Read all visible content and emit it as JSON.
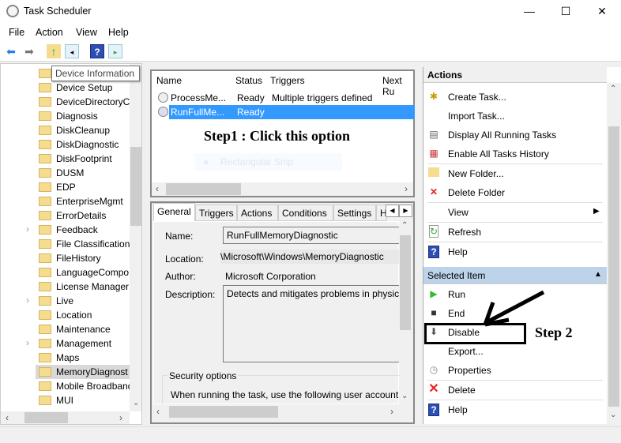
{
  "window": {
    "title": "Task Scheduler",
    "minimize": "—",
    "maximize": "☐",
    "close": "✕"
  },
  "menu": [
    "File",
    "Action",
    "View",
    "Help"
  ],
  "toolbar": {
    "icons": [
      "back-arrow-icon",
      "forward-arrow-icon",
      "up-folder-icon",
      "show-hide-console-tree-icon",
      "help-icon",
      "show-hide-action-pane-icon"
    ]
  },
  "tree": {
    "tooltip": "Device Information",
    "items": [
      {
        "label": "Device Information",
        "expandable": false
      },
      {
        "label": "Device Setup",
        "expandable": false
      },
      {
        "label": "DeviceDirectoryCl",
        "expandable": false
      },
      {
        "label": "Diagnosis",
        "expandable": false
      },
      {
        "label": "DiskCleanup",
        "expandable": false
      },
      {
        "label": "DiskDiagnostic",
        "expandable": false
      },
      {
        "label": "DiskFootprint",
        "expandable": false
      },
      {
        "label": "DUSM",
        "expandable": false
      },
      {
        "label": "EDP",
        "expandable": false
      },
      {
        "label": "EnterpriseMgmt",
        "expandable": false
      },
      {
        "label": "ErrorDetails",
        "expandable": false
      },
      {
        "label": "Feedback",
        "expandable": true
      },
      {
        "label": "File Classification",
        "expandable": false
      },
      {
        "label": "FileHistory",
        "expandable": false
      },
      {
        "label": "LanguageCompo",
        "expandable": false
      },
      {
        "label": "License Manager",
        "expandable": false
      },
      {
        "label": "Live",
        "expandable": true
      },
      {
        "label": "Location",
        "expandable": false
      },
      {
        "label": "Maintenance",
        "expandable": false
      },
      {
        "label": "Management",
        "expandable": true
      },
      {
        "label": "Maps",
        "expandable": false
      },
      {
        "label": "MemoryDiagnost",
        "expandable": false,
        "selected": true
      },
      {
        "label": "Mobile Broadband",
        "expandable": false
      },
      {
        "label": "MUI",
        "expandable": false
      }
    ]
  },
  "tasklist": {
    "columns": [
      "Name",
      "Status",
      "Triggers",
      "Next Ru"
    ],
    "rows": [
      {
        "name": "ProcessMe...",
        "status": "Ready",
        "triggers": "Multiple triggers defined"
      },
      {
        "name": "RunFullMe...",
        "status": "Ready",
        "triggers": "",
        "selected": true
      }
    ],
    "ghost_overlay": "Rectangular Snip"
  },
  "annotations": {
    "step1": "Step1 : Click this option",
    "step2": "Step 2"
  },
  "details": {
    "tabs": [
      "General",
      "Triggers",
      "Actions",
      "Conditions",
      "Settings",
      "H"
    ],
    "active_tab": "General",
    "name_label": "Name:",
    "name_value": "RunFullMemoryDiagnostic",
    "location_label": "Location:",
    "location_value": "\\Microsoft\\Windows\\MemoryDiagnostic",
    "author_label": "Author:",
    "author_value": "Microsoft Corporation",
    "description_label": "Description:",
    "description_value": "Detects and mitigates problems in physica",
    "security_title": "Security options",
    "security_text": "When running the task, use the following user account:"
  },
  "actions": {
    "header": "Actions",
    "items": [
      {
        "label": "Create Task...",
        "icon": "create-task-icon"
      },
      {
        "label": "Import Task...",
        "icon": ""
      },
      {
        "label": "Display All Running Tasks",
        "icon": "running-tasks-icon"
      },
      {
        "label": "Enable All Tasks History",
        "icon": "history-icon"
      },
      {
        "label": "New Folder...",
        "icon": "new-folder-icon"
      },
      {
        "label": "Delete Folder",
        "icon": "delete-folder-icon"
      },
      {
        "label": "View",
        "icon": "",
        "submenu": true
      },
      {
        "label": "Refresh",
        "icon": "refresh-icon"
      },
      {
        "label": "Help",
        "icon": "help-icon"
      }
    ],
    "selected_header": "Selected Item",
    "selected_items": [
      {
        "label": "Run",
        "icon": "run-icon"
      },
      {
        "label": "End",
        "icon": "end-icon"
      },
      {
        "label": "Disable",
        "icon": "disable-icon"
      },
      {
        "label": "Export...",
        "icon": ""
      },
      {
        "label": "Properties",
        "icon": "properties-icon"
      },
      {
        "label": "Delete",
        "icon": "delete-icon"
      },
      {
        "label": "Help",
        "icon": "help-icon"
      }
    ]
  },
  "colors": {
    "selection": "#3399ff",
    "section_header": "#bcd3ea",
    "folder": "#f5dc8e"
  }
}
